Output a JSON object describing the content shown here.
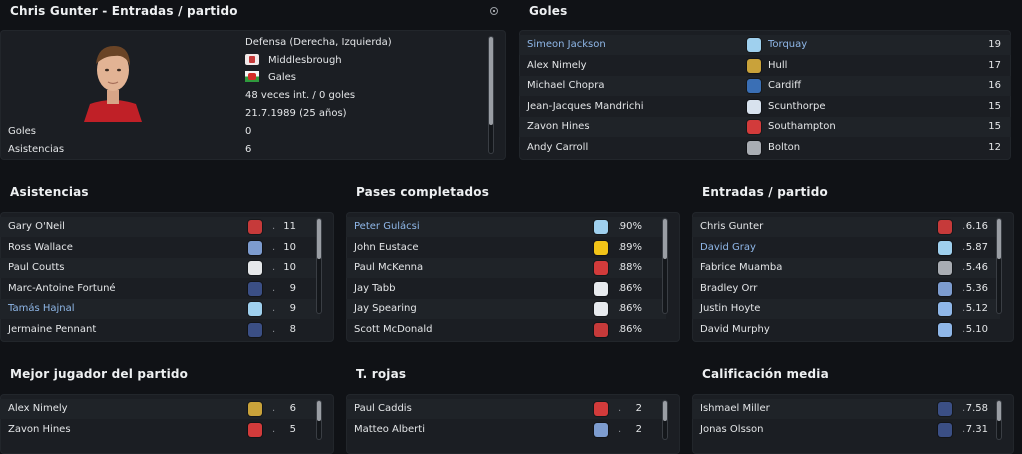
{
  "player_panel": {
    "title": "Chris Gunter - Entradas / partido",
    "position": "Defensa (Derecha, Izquierda)",
    "club": "Middlesbrough",
    "nation": "Gales",
    "caps": "48 veces int. / 0 goles",
    "dob": "21.7.1989 (25 años)",
    "stats": [
      {
        "label": "Goles",
        "value": "0"
      },
      {
        "label": "Asistencias",
        "value": "6"
      }
    ]
  },
  "goals": {
    "title": "Goles",
    "rows": [
      {
        "name": "Simeon Jackson",
        "highlight": true,
        "club": "Torquay",
        "club_highlight": true,
        "value": "19",
        "icon": "torquay-badge-icon",
        "color": "#9fd0ee"
      },
      {
        "name": "Alex Nimely",
        "highlight": false,
        "club": "Hull",
        "club_highlight": false,
        "value": "17",
        "icon": "hull-badge-icon",
        "color": "#c9a23a"
      },
      {
        "name": "Michael Chopra",
        "highlight": false,
        "club": "Cardiff",
        "club_highlight": false,
        "value": "16",
        "icon": "cardiff-badge-icon",
        "color": "#3a6fb5"
      },
      {
        "name": "Jean-Jacques Mandrichi",
        "highlight": false,
        "club": "Scunthorpe",
        "club_highlight": false,
        "value": "15",
        "icon": "scunthorpe-badge-icon",
        "color": "#d8e2ee"
      },
      {
        "name": "Zavon Hines",
        "highlight": false,
        "club": "Southampton",
        "club_highlight": false,
        "value": "15",
        "icon": "southampton-badge-icon",
        "color": "#d23b3b"
      },
      {
        "name": "Andy Carroll",
        "highlight": false,
        "club": "Bolton",
        "club_highlight": false,
        "value": "12",
        "icon": "bolton-badge-icon",
        "color": "#a9adb3"
      }
    ]
  },
  "assists": {
    "title": "Asistencias",
    "rows": [
      {
        "name": "Gary O'Neil",
        "highlight": false,
        "value": "11",
        "icon": "middlesbrough-badge-icon",
        "color": "#c63a3a"
      },
      {
        "name": "Ross Wallace",
        "highlight": false,
        "value": "10",
        "icon": "qpr-badge-icon",
        "color": "#7d9ccf"
      },
      {
        "name": "Paul Coutts",
        "highlight": false,
        "value": "10",
        "icon": "derby-badge-icon",
        "color": "#e6e8ea"
      },
      {
        "name": "Marc-Antoine Fortuné",
        "highlight": false,
        "value": "9",
        "icon": "wba-badge-icon",
        "color": "#3b4f85"
      },
      {
        "name": "Tamás Hajnal",
        "highlight": true,
        "value": "9",
        "icon": "torquay-badge-icon",
        "color": "#9fd0ee"
      },
      {
        "name": "Jermaine Pennant",
        "highlight": false,
        "value": "8",
        "icon": "wba-badge-icon",
        "color": "#3b4f85"
      }
    ]
  },
  "passes": {
    "title": "Pases completados",
    "rows": [
      {
        "name": "Peter Gulácsi",
        "highlight": true,
        "value": "90%",
        "icon": "torquay-badge-icon",
        "color": "#9fd0ee"
      },
      {
        "name": "John Eustace",
        "highlight": false,
        "value": "89%",
        "icon": "watford-badge-icon",
        "color": "#f2c418"
      },
      {
        "name": "Paul McKenna",
        "highlight": false,
        "value": "88%",
        "icon": "nottingham-badge-icon",
        "color": "#d23b3b"
      },
      {
        "name": "Jay Tabb",
        "highlight": false,
        "value": "86%",
        "icon": "reading-badge-icon",
        "color": "#e7eaee"
      },
      {
        "name": "Jay Spearing",
        "highlight": false,
        "value": "86%",
        "icon": "blackburn-badge-icon",
        "color": "#e7eaee"
      },
      {
        "name": "Scott McDonald",
        "highlight": false,
        "value": "86%",
        "icon": "middlesbrough-badge-icon",
        "color": "#c63a3a"
      }
    ]
  },
  "tackles": {
    "title": "Entradas / partido",
    "rows": [
      {
        "name": "Chris Gunter",
        "highlight": false,
        "value": "6.16",
        "icon": "middlesbrough-badge-icon",
        "color": "#c63a3a"
      },
      {
        "name": "David Gray",
        "highlight": true,
        "value": "5.87",
        "icon": "torquay-badge-icon",
        "color": "#9fd0ee"
      },
      {
        "name": "Fabrice Muamba",
        "highlight": false,
        "value": "5.46",
        "icon": "bolton-badge-icon",
        "color": "#a9adb3"
      },
      {
        "name": "Bradley Orr",
        "highlight": false,
        "value": "5.36",
        "icon": "qpr-badge-icon",
        "color": "#7d9ccf"
      },
      {
        "name": "Justin Hoyte",
        "highlight": false,
        "value": "5.12",
        "icon": "coventry-badge-icon",
        "color": "#8fb7e8"
      },
      {
        "name": "David Murphy",
        "highlight": false,
        "value": "5.10",
        "icon": "coventry-badge-icon",
        "color": "#8fb7e8"
      }
    ]
  },
  "motm": {
    "title": "Mejor jugador del partido",
    "rows": [
      {
        "name": "Alex Nimely",
        "highlight": false,
        "value": "6",
        "icon": "hull-badge-icon",
        "color": "#c9a23a"
      },
      {
        "name": "Zavon Hines",
        "highlight": false,
        "value": "5",
        "icon": "southampton-badge-icon",
        "color": "#d23b3b"
      }
    ]
  },
  "red_cards": {
    "title": "T. rojas",
    "rows": [
      {
        "name": "Paul Caddis",
        "highlight": false,
        "value": "2",
        "icon": "nottingham-badge-icon",
        "color": "#d23b3b"
      },
      {
        "name": "Matteo Alberti",
        "highlight": false,
        "value": "2",
        "icon": "qpr-badge-icon",
        "color": "#7d9ccf"
      }
    ]
  },
  "avg_rating": {
    "title": "Calificación media",
    "rows": [
      {
        "name": "Ishmael Miller",
        "highlight": false,
        "value": "7.58",
        "icon": "wba-badge-icon",
        "color": "#3b4f85"
      },
      {
        "name": "Jonas Olsson",
        "highlight": false,
        "value": "7.31",
        "icon": "wba-badge-icon",
        "color": "#3b4f85"
      }
    ]
  },
  "dot_glyph": "."
}
